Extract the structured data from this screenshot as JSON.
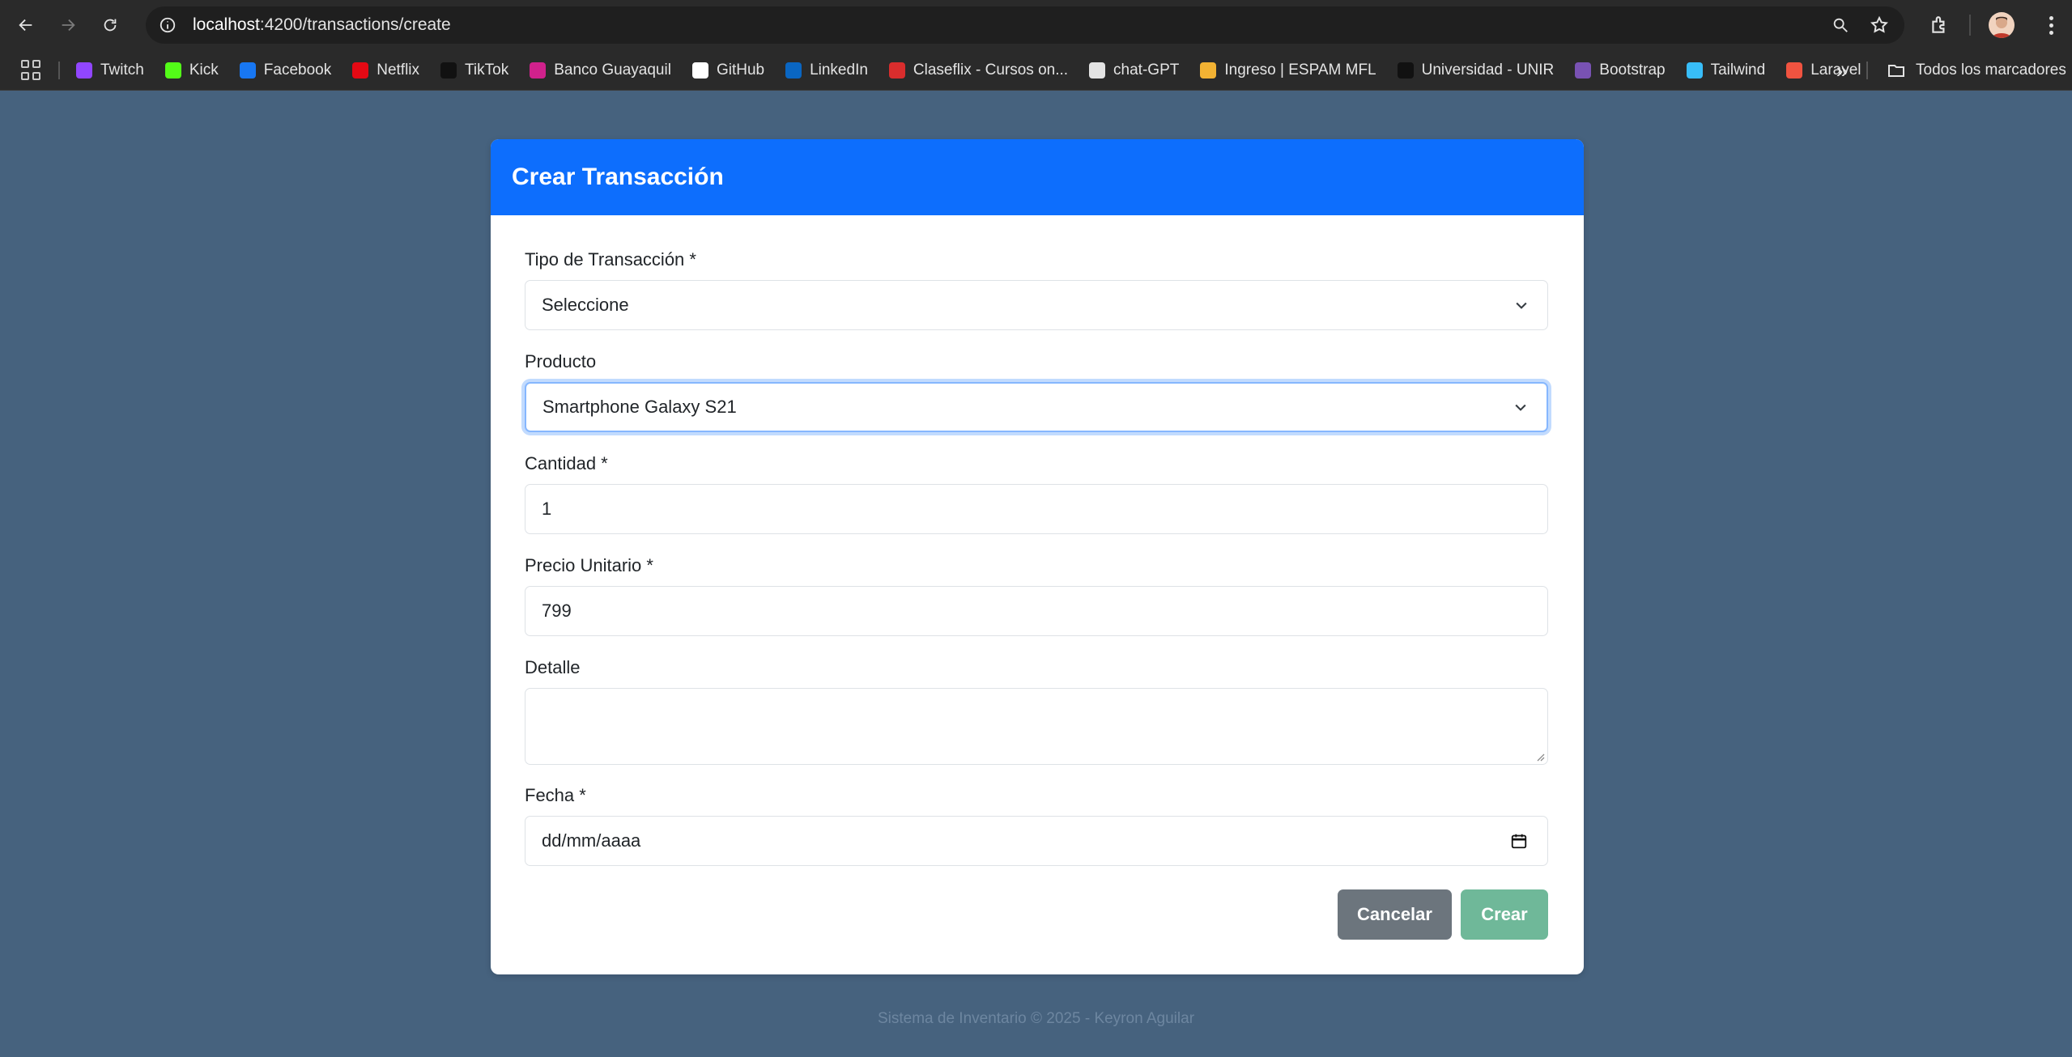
{
  "browser": {
    "url_host": "localhost",
    "url_rest": ":4200/transactions/create",
    "bookmarks": [
      {
        "label": "Twitch",
        "color": "#9146ff"
      },
      {
        "label": "Kick",
        "color": "#53fc18"
      },
      {
        "label": "Facebook",
        "color": "#1877f2"
      },
      {
        "label": "Netflix",
        "color": "#e50914"
      },
      {
        "label": "TikTok",
        "color": "#111111"
      },
      {
        "label": "Banco Guayaquil",
        "color": "#d0218c"
      },
      {
        "label": "GitHub",
        "color": "#ffffff"
      },
      {
        "label": "LinkedIn",
        "color": "#0a66c2"
      },
      {
        "label": "Claseflix - Cursos on...",
        "color": "#d92d2d"
      },
      {
        "label": "chat-GPT",
        "color": "#e3e3e3"
      },
      {
        "label": "Ingreso | ESPAM MFL",
        "color": "#f2b233"
      },
      {
        "label": "Universidad - UNIR",
        "color": "#111111"
      },
      {
        "label": "Bootstrap",
        "color": "#7952b3"
      },
      {
        "label": "Tailwind",
        "color": "#38bdf8"
      },
      {
        "label": "Laravel",
        "color": "#f05340"
      }
    ],
    "more_label": "»",
    "folder_label": "Todos los marcadores"
  },
  "form": {
    "title": "Crear Transacción",
    "tipo_label": "Tipo de Transacción *",
    "tipo_value": "Seleccione",
    "producto_label": "Producto",
    "producto_value": "Smartphone Galaxy S21",
    "cantidad_label": "Cantidad *",
    "cantidad_value": "1",
    "precio_label": "Precio Unitario *",
    "precio_value": "799",
    "detalle_label": "Detalle",
    "detalle_value": "",
    "fecha_label": "Fecha *",
    "fecha_placeholder": "dd/mm/aaaa",
    "cancel_label": "Cancelar",
    "create_label": "Crear"
  },
  "colors": {
    "header": "#0d6efd",
    "cancel": "#6c757d",
    "create": "#6fb899",
    "page_bg": "#46627e"
  },
  "footer": {
    "text": "Sistema de Inventario © 2025 - Keyron Aguilar"
  }
}
